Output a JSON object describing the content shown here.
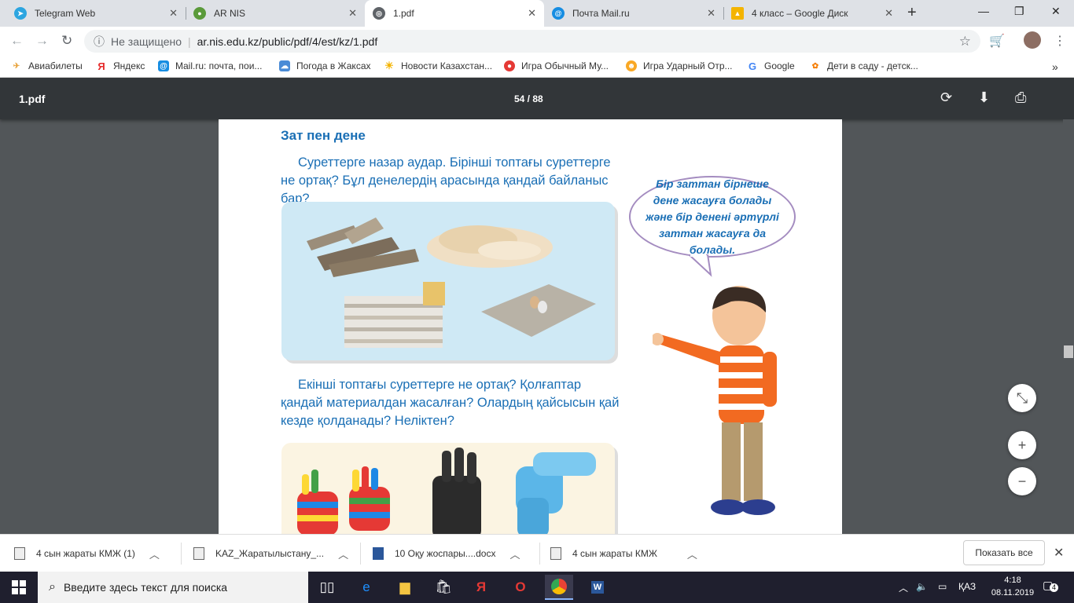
{
  "tabs": [
    {
      "title": "Telegram Web",
      "icon": "telegram-icon",
      "color": "#2ca5e0"
    },
    {
      "title": "AR NIS",
      "icon": "globe-icon",
      "color": "#5a9a3a"
    },
    {
      "title": "1.pdf",
      "icon": "globe-icon",
      "color": "#5f6368"
    },
    {
      "title": "Почта Mail.ru",
      "icon": "mail-icon",
      "color": "#168de2"
    },
    {
      "title": "4 класс – Google Диск",
      "icon": "google-drive-icon",
      "color": "#f4b400"
    }
  ],
  "toolbar": {
    "security": "Не защищено",
    "url": "ar.nis.edu.kz/public/pdf/4/est/kz/1.pdf"
  },
  "bookmarks": [
    {
      "label": "Авиабилеты",
      "icon": "plane-icon"
    },
    {
      "label": "Яндекс",
      "icon": "yandex-icon"
    },
    {
      "label": "Mail.ru: почта, пои...",
      "icon": "mail-icon"
    },
    {
      "label": "Погода в Жаксах",
      "icon": "weather-icon"
    },
    {
      "label": "Новости Казахстан...",
      "icon": "sun-icon"
    },
    {
      "label": "Игра Обычный Му...",
      "icon": "game-icon"
    },
    {
      "label": "Игра Ударный Отр...",
      "icon": "game-icon"
    },
    {
      "label": "Google",
      "icon": "google-icon"
    },
    {
      "label": "Дети в саду - детск...",
      "icon": "kids-icon"
    }
  ],
  "pdf": {
    "title": "1.pdf",
    "pages": "54 / 88"
  },
  "content": {
    "heading": "Зат пен дене",
    "para1": "Суреттерге назар аудар. Бірінші топтағы суреттерге не ортақ? Бұл денелердің арасында қандай байланыс бар?",
    "para2": "Екінші топтағы суреттерге не ортақ? Қолғаптар қандай материалдан жасалған? Олардың қайсысын қай кезде қолданады? Неліктен?",
    "bubble": "Бір заттан бірнеше дене жасауға болады және бір денені әртүрлі заттан жасауға да болады."
  },
  "downloads": [
    {
      "name": "4 сын жараты КМЖ (1)"
    },
    {
      "name": "KAZ_Жаратылыстану_..."
    },
    {
      "name": "10 Оқу жоспары....docx"
    },
    {
      "name": "4 сын жараты КМЖ"
    }
  ],
  "downloads_show_all": "Показать все",
  "taskbar": {
    "search_placeholder": "Введите здесь текст для поиска",
    "lang": "ҚАЗ",
    "time": "4:18",
    "date": "08.11.2019",
    "notifications": "4"
  },
  "colors": {
    "text_blue": "#1a6fb5",
    "bubble_border": "#a48cc0",
    "pdf_bar": "#323639",
    "pdf_bg": "#525659"
  }
}
